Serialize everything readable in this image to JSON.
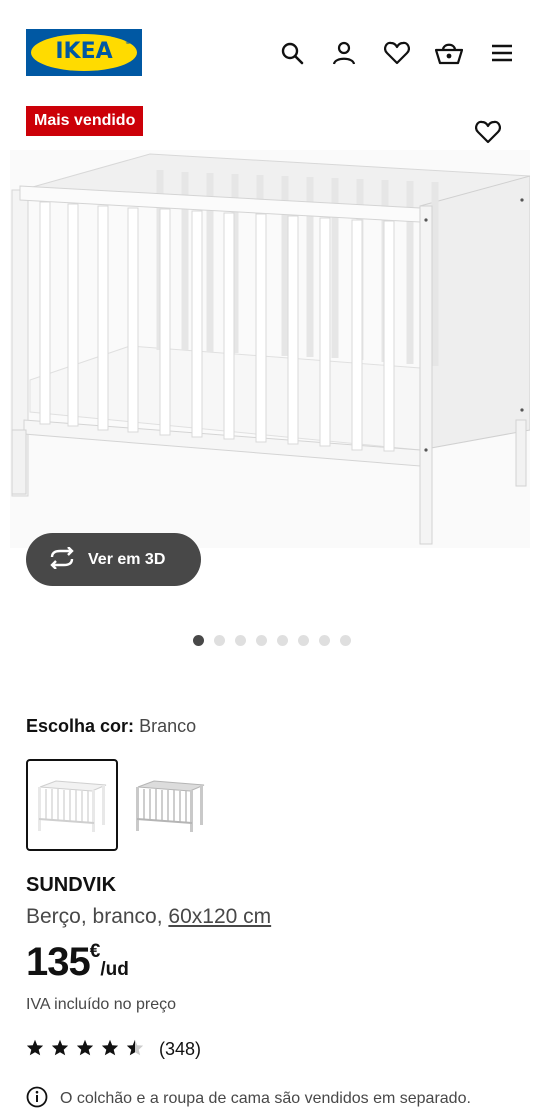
{
  "brand": {
    "logo_text": "IKEA",
    "logo_mark": "®"
  },
  "header": {
    "icons": [
      "search-icon",
      "account-icon",
      "favourites-icon",
      "shopping-bag-icon",
      "menu-icon"
    ]
  },
  "badge": {
    "label": "Mais vendido"
  },
  "gallery": {
    "view_3d_label": "Ver em 3D",
    "dot_count": 8,
    "active_index": 0
  },
  "color_chooser": {
    "label": "Escolha cor:",
    "selected_value": "Branco",
    "options": [
      "white-crib-swatch",
      "grey-crib-swatch"
    ]
  },
  "product": {
    "name": "SUNDVIK",
    "description": "Berço, branco, ",
    "size_link": "60x120 cm",
    "price_integer": "135",
    "price_currency": "€",
    "price_unit": "/ud",
    "vat_note": "IVA incluído no preço",
    "rating": 4.5,
    "rating_max": 5,
    "review_count": "(348)"
  },
  "notice": {
    "text": "O colchão e a roupa de cama são vendidos em separado."
  },
  "colors": {
    "ikea_blue": "#0058a3",
    "ikea_yellow": "#ffdb00",
    "badge_red": "#cc0008",
    "dark_grey": "#484848"
  }
}
